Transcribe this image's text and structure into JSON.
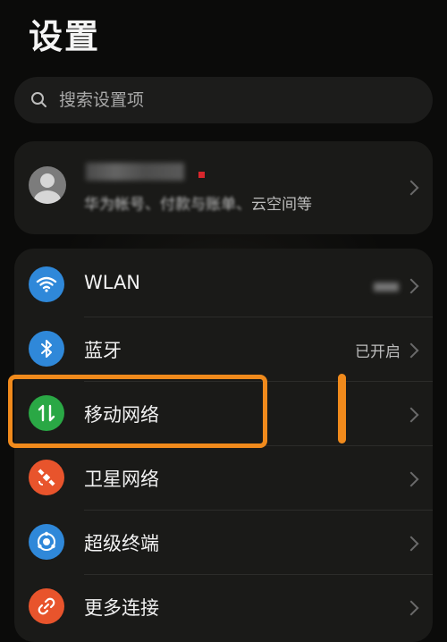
{
  "header": {
    "title": "设置"
  },
  "search": {
    "placeholder": "搜索设置项",
    "icon": "search-icon"
  },
  "account": {
    "subtitle_prefix": "华为帐号、付款与账单、",
    "subtitle_suffix": "云空间等",
    "icon": "avatar-icon"
  },
  "settings": {
    "items": [
      {
        "label": "WLAN",
        "icon": "wifi-icon",
        "color": "#2f88d9",
        "status": ""
      },
      {
        "label": "蓝牙",
        "icon": "bluetooth-icon",
        "color": "#2f88d9",
        "status": "已开启"
      },
      {
        "label": "移动网络",
        "icon": "mobile-data-icon",
        "color": "#2aa845",
        "status": ""
      },
      {
        "label": "卫星网络",
        "icon": "satellite-icon",
        "color": "#e8542c",
        "status": ""
      },
      {
        "label": "超级终端",
        "icon": "super-device-icon",
        "color": "#2f88d9",
        "status": ""
      },
      {
        "label": "更多连接",
        "icon": "link-icon",
        "color": "#e8542c",
        "status": ""
      }
    ]
  },
  "annotation": {
    "color": "#f08a1c"
  }
}
